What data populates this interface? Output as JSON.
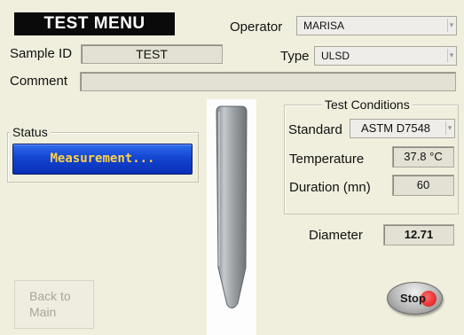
{
  "header": {
    "menu_title": "TEST MENU",
    "operator_label": "Operator",
    "operator_value": "MARISA"
  },
  "sample": {
    "id_label": "Sample ID",
    "id_value": "TEST",
    "type_label": "Type",
    "type_value": "ULSD",
    "comment_label": "Comment",
    "comment_value": ""
  },
  "status": {
    "label": "Status",
    "value": "Measurement..."
  },
  "test_conditions": {
    "title": "Test Conditions",
    "standard_label": "Standard",
    "standard_value": "ASTM D7548",
    "temperature_label": "Temperature",
    "temperature_value": "37.8 °C",
    "duration_label": "Duration (mn)",
    "duration_value": "60"
  },
  "diameter": {
    "label": "Diameter",
    "value": "12.71"
  },
  "buttons": {
    "back_line1": "Back to",
    "back_line2": "Main",
    "stop": "Stop"
  },
  "icons": {
    "dropdown": "chevron-down-icon",
    "stop_indicator": "red-dot-icon"
  },
  "colors": {
    "background": "#f0eedd",
    "status_blue": "#1345d0",
    "status_text": "#ffd24a",
    "stop_red": "#d81010"
  }
}
